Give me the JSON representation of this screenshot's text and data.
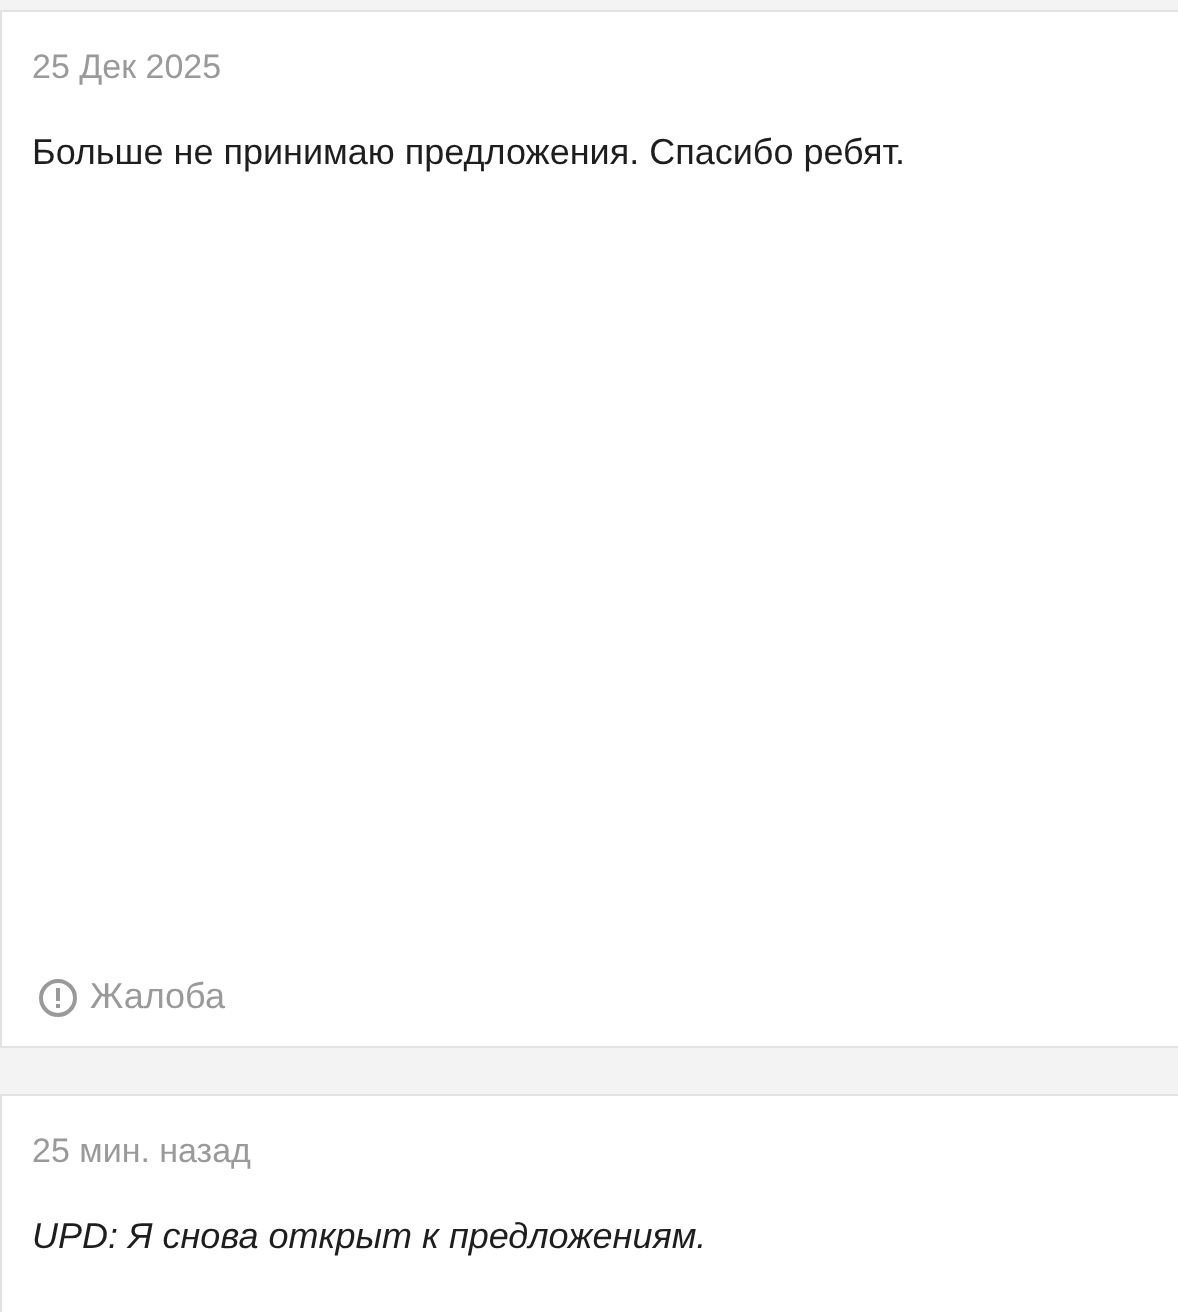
{
  "posts": [
    {
      "date": "25 Дек 2025",
      "text": "Больше не принимаю предложения. Спасибо ребят.",
      "kind": "plain",
      "report": "Жалоба"
    },
    {
      "date": "25 мин. назад",
      "text": "UPD: Я снова открыт к предложениям.",
      "kind": "emphasis"
    }
  ]
}
